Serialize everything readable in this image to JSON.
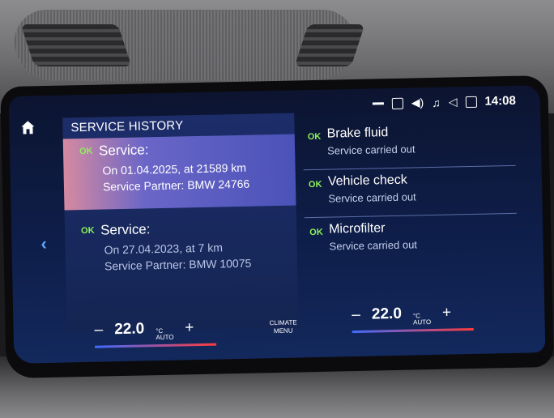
{
  "status_bar": {
    "clock": "14:08"
  },
  "icons": [
    "home-icon",
    "chevron-left-icon",
    "signal-icon",
    "route-icon",
    "volume-icon",
    "music-icon",
    "speaker-icon",
    "message-icon"
  ],
  "left_panel": {
    "title": "SERVICE HISTORY",
    "entries": [
      {
        "status": "OK",
        "heading": "Service:",
        "date_line": "On 01.04.2025, at 21589 km",
        "partner_line": "Service Partner: BMW 24766"
      },
      {
        "status": "OK",
        "heading": "Service:",
        "date_line": "On 27.04.2023, at 7 km",
        "partner_line": "Service Partner: BMW 10075"
      }
    ]
  },
  "right_panel": {
    "items": [
      {
        "status": "OK",
        "title": "Brake fluid",
        "subtitle": "Service carried out"
      },
      {
        "status": "OK",
        "title": "Vehicle check",
        "subtitle": "Service carried out"
      },
      {
        "status": "OK",
        "title": "Microfilter",
        "subtitle": "Service carried out"
      }
    ]
  },
  "climate": {
    "left": {
      "minus": "–",
      "temp": "22.0",
      "unit": "°C",
      "mode": "AUTO",
      "plus": "+"
    },
    "right": {
      "minus": "–",
      "temp": "22.0",
      "unit": "°C",
      "mode": "AUTO",
      "plus": "+"
    },
    "menu_line1": "CLIMATE",
    "menu_line2": "MENU"
  },
  "colors": {
    "ok_green": "#8cf05a",
    "accent_blue": "#5fa8ff",
    "selected_start": "#d68aa0",
    "selected_end": "#4a52b8"
  }
}
